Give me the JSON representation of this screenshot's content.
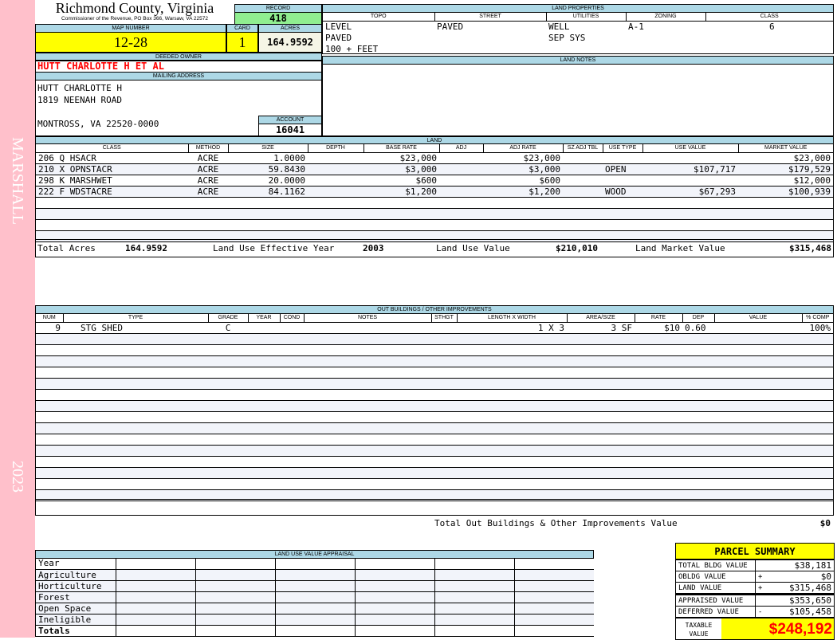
{
  "side": {
    "district": "MARSHALL",
    "year": "2023"
  },
  "header": {
    "county": "Richmond County, Virginia",
    "subtitle": "Commissioner of the Revenue, PO Box 366, Warsaw, VA 22572",
    "record_label": "RECORD",
    "record": "418",
    "map_label": "MAP NUMBER",
    "map": "12-28",
    "card_label": "CARD",
    "card": "1",
    "acres_label": "ACRES",
    "acres": "164.9592"
  },
  "owner": {
    "label": "DEEDED OWNER",
    "name": "HUTT CHARLOTTE H ET AL",
    "mailing_label": "MAILING ADDRESS",
    "line1": "HUTT CHARLOTTE H",
    "line2": "1819 NEENAH ROAD",
    "line3": "MONTROSS, VA 22520-0000",
    "account_label": "ACCOUNT",
    "account": "16041"
  },
  "land_properties": {
    "label": "LAND PROPERTIES",
    "columns": [
      "TOPO",
      "STREET",
      "UTILITIES",
      "ZONING",
      "CLASS"
    ],
    "topo": [
      "LEVEL",
      "PAVED",
      "100 + FEET"
    ],
    "street": "PAVED",
    "utilities": [
      "WELL",
      "SEP SYS"
    ],
    "zoning": "A-1",
    "class": "6"
  },
  "land_notes": {
    "label": "LAND NOTES"
  },
  "land": {
    "label": "LAND",
    "columns": [
      "CLASS",
      "METHOD",
      "SIZE",
      "DEPTH",
      "BASE RATE",
      "ADJ",
      "ADJ RATE",
      "SZ ADJ TBL",
      "USE TYPE",
      "USE VALUE",
      "MARKET VALUE"
    ],
    "rows": [
      [
        "206 Q HSACR",
        "ACRE",
        "1.0000",
        "",
        "$23,000",
        "",
        "$23,000",
        "",
        "",
        "",
        "$23,000"
      ],
      [
        "210 X OPNSTACR",
        "ACRE",
        "59.8430",
        "",
        "$3,000",
        "",
        "$3,000",
        "",
        "OPEN",
        "$107,717",
        "$179,529"
      ],
      [
        "298 K MARSHWET",
        "ACRE",
        "20.0000",
        "",
        "$600",
        "",
        "$600",
        "",
        "",
        "",
        "$12,000"
      ],
      [
        "222 F WDSTACRE",
        "ACRE",
        "84.1162",
        "",
        "$1,200",
        "",
        "$1,200",
        "",
        "WOOD",
        "$67,293",
        "$100,939"
      ]
    ],
    "total_acres_label": "Total Acres",
    "total_acres": "164.9592",
    "eff_year_label": "Land Use Effective Year",
    "eff_year": "2003",
    "use_value_label": "Land Use Value",
    "use_value": "$210,010",
    "market_label": "Land Market Value",
    "market": "$315,468"
  },
  "outbuildings": {
    "label": "OUT BUILDINGS / OTHER IMPROVEMENTS",
    "columns": [
      "NUM",
      "TYPE",
      "GRADE",
      "YEAR",
      "COND",
      "NOTES",
      "STHGT",
      "LENGTH X WIDTH",
      "AREA/SIZE",
      "RATE",
      "DEP",
      "VALUE",
      "% COMP"
    ],
    "rows": [
      [
        "9",
        "STG SHED",
        "C",
        "",
        "",
        "",
        "",
        "1 X 3",
        "3 SF",
        "$10",
        "0.60",
        "",
        "100%"
      ]
    ],
    "total_label": "Total Out Buildings & Other Improvements Value",
    "total": "$0"
  },
  "luva": {
    "label": "LAND USE VALUE APPRAISAL",
    "rows": [
      "Year",
      "Agriculture",
      "Horticulture",
      "Forest",
      "Open Space",
      "Ineligible",
      "Totals"
    ]
  },
  "summary": {
    "title": "PARCEL SUMMARY",
    "rows": [
      {
        "label": "TOTAL BLDG VALUE",
        "op": "",
        "value": "$38,181"
      },
      {
        "label": "OBLDG VALUE",
        "op": "+",
        "value": "$0"
      },
      {
        "label": "LAND VALUE",
        "op": "+",
        "value": "$315,468"
      },
      {
        "label": "APPRAISED VALUE",
        "op": "",
        "value": "$353,650"
      },
      {
        "label": "DEFERRED VALUE",
        "op": "-",
        "value": "$105,458"
      }
    ],
    "taxable_label": "TAXABLE VALUE",
    "taxable": "$248,192"
  },
  "colors": {
    "header": "#add8e6",
    "highlight": "#ffff00",
    "record": "#90ee90",
    "owner": "#ff0000",
    "strip": "#ffc0cb"
  }
}
